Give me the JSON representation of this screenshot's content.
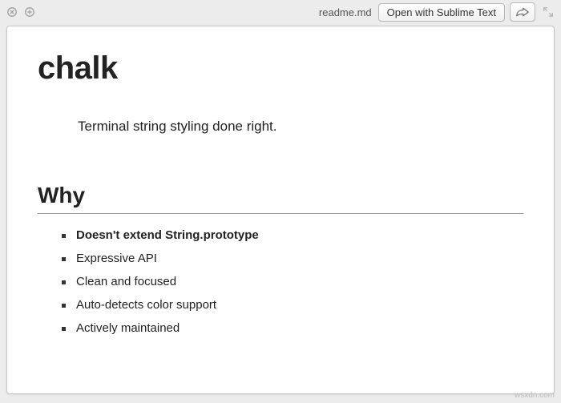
{
  "toolbar": {
    "filename": "readme.md",
    "open_label": "Open with Sublime Text"
  },
  "doc": {
    "title": "chalk",
    "tagline": "Terminal string styling done right.",
    "section_heading": "Why",
    "reasons": [
      {
        "text": "Doesn't extend String.prototype",
        "bold": true
      },
      {
        "text": "Expressive API",
        "bold": false
      },
      {
        "text": "Clean and focused",
        "bold": false
      },
      {
        "text": "Auto-detects color support",
        "bold": false
      },
      {
        "text": "Actively maintained",
        "bold": false
      }
    ]
  },
  "watermark": "wsxdn.com"
}
